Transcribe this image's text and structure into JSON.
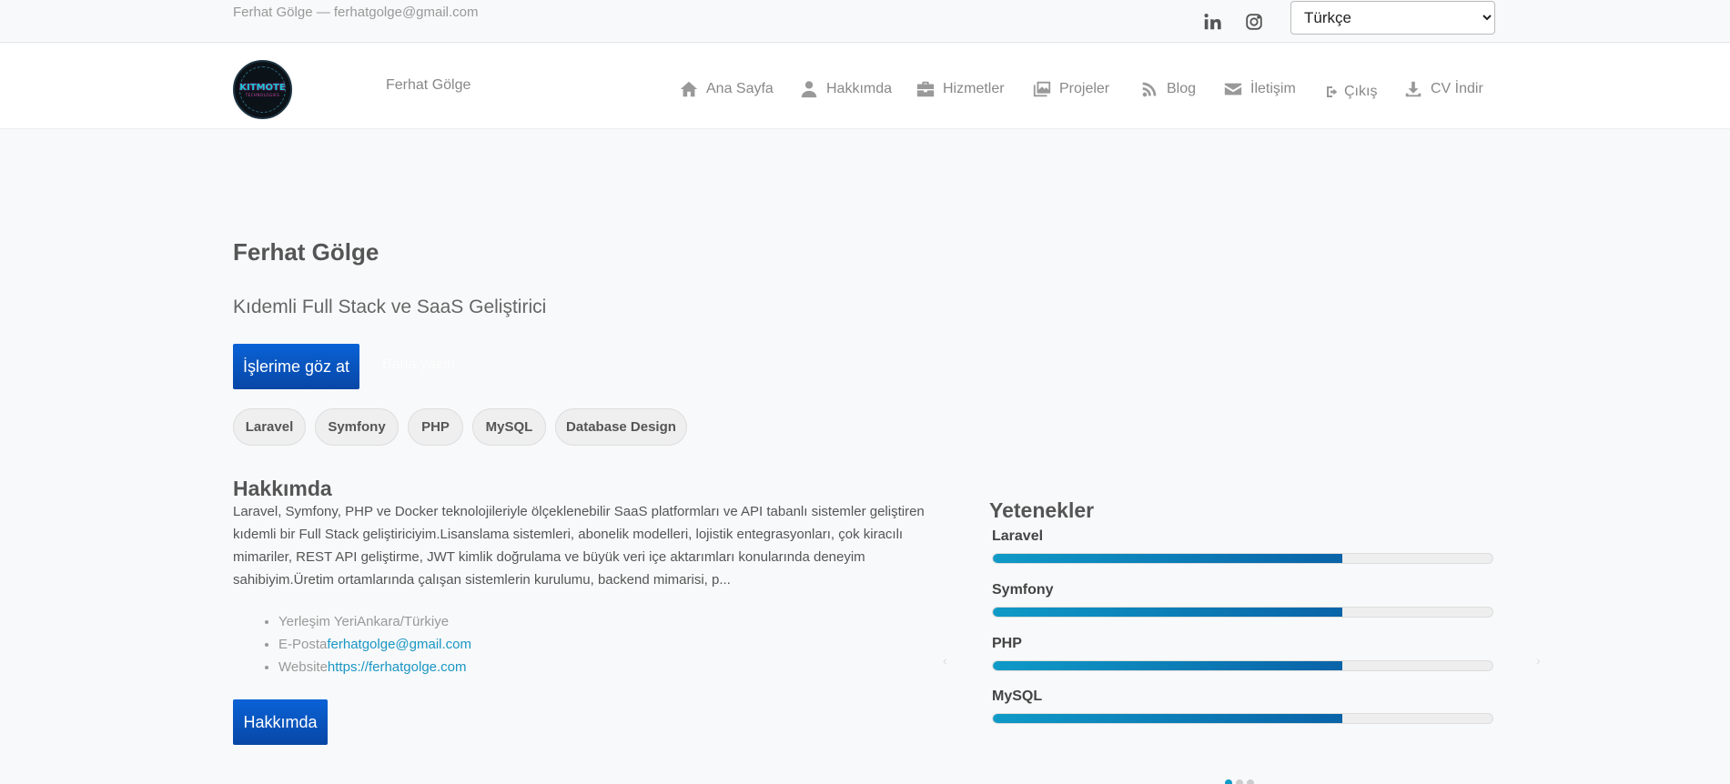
{
  "topbar": {
    "contact": "Ferhat Gölge — ferhatgolge@gmail.com",
    "language": {
      "selected": "Türkçe",
      "options": [
        "Türkçe"
      ]
    },
    "social": [
      "linkedin-icon",
      "instagram-icon"
    ]
  },
  "navbar": {
    "brand_name": "Ferhat Gölge",
    "logo": {
      "main": "KITMOTE",
      "sub": "TECHNOLOGIES"
    },
    "items": [
      {
        "label": "Ana Sayfa",
        "icon": "home-icon"
      },
      {
        "label": "Hakkımda",
        "icon": "user-icon"
      },
      {
        "label": "Hizmetler",
        "icon": "briefcase-icon"
      },
      {
        "label": "Projeler",
        "icon": "images-icon"
      },
      {
        "label": "Blog",
        "icon": "blog-icon"
      },
      {
        "label": "İletişim",
        "icon": "envelope-icon"
      },
      {
        "label": "Çıkış",
        "icon": "logout-icon"
      },
      {
        "label": "CV İndir",
        "icon": "download-icon"
      }
    ]
  },
  "hero": {
    "name": "Ferhat Gölge",
    "subtitle": "Kıdemli Full Stack ve SaaS Geliştirici",
    "primary_button": "İşlerime göz at",
    "secondary_button": "Bana yazın",
    "tags": [
      "Laravel",
      "Symfony",
      "PHP",
      "MySQL",
      "Database Design"
    ]
  },
  "about": {
    "title": "Hakkımda",
    "text": "Laravel, Symfony, PHP ve Docker teknolojileriyle ölçeklenebilir SaaS platformları ve API tabanlı sistemler geliştiren kıdemli bir Full Stack geliştiriciyim.Lisanslama sistemleri, abonelik modelleri, lojistik entegrasyonları, çok kiracılı mimariler, REST API geliştirme, JWT kimlik doğrulama ve büyük veri içe aktarımları konularında deneyim sahibiyim.Üretim ortamlarında çalışan sistemlerin kurulumu, backend mimarisi, p...",
    "info": [
      {
        "label": "Yerleşim Yeri",
        "value": "Ankara/Türkiye",
        "link": false
      },
      {
        "label": "E-Posta",
        "value": "ferhatgolge@gmail.com",
        "link": true
      },
      {
        "label": "Website",
        "value": "https://ferhatgolge.com",
        "link": true
      }
    ],
    "button": "Hakkımda"
  },
  "skills": {
    "title": "Yetenekler",
    "items": [
      {
        "name": "Laravel",
        "level": 0.7
      },
      {
        "name": "Symfony",
        "level": 0.7
      },
      {
        "name": "PHP",
        "level": 0.7
      },
      {
        "name": "MySQL",
        "level": 0.7
      }
    ],
    "accent": "#0f9ac7",
    "slide_count": 3,
    "active_slide": 0
  },
  "colors": {
    "primary": "#0747a6",
    "link": "#1996c4"
  }
}
